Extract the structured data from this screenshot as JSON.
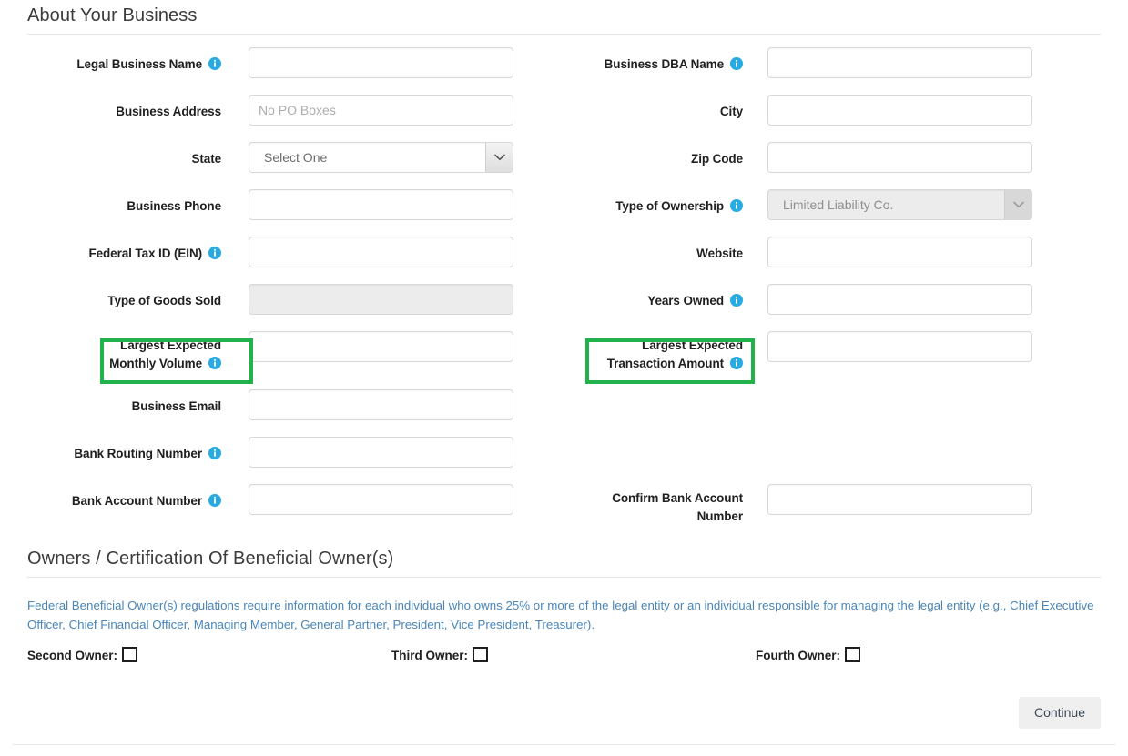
{
  "sections": {
    "business": {
      "title": "About Your Business"
    },
    "owners": {
      "title": "Owners / Certification Of Beneficial Owner(s)",
      "note": "Federal Beneficial Owner(s) regulations require information for each individual who owns 25% or more of the legal entity or an individual responsible for managing the legal entity (e.g., Chief Executive Officer, Chief Financial Officer, Managing Member, General Partner, President, Vice President, Treasurer).",
      "checkboxes": [
        {
          "label": "Second Owner:",
          "checked": false
        },
        {
          "label": "Third Owner:",
          "checked": false
        },
        {
          "label": "Fourth Owner:",
          "checked": false
        }
      ]
    }
  },
  "fields": {
    "legal_business_name": {
      "label": "Legal Business Name",
      "value": "",
      "placeholder": "",
      "info": true,
      "type": "text",
      "disabled": false
    },
    "business_dba_name": {
      "label": "Business DBA Name",
      "value": "",
      "placeholder": "",
      "info": true,
      "type": "text",
      "disabled": false
    },
    "business_address": {
      "label": "Business Address",
      "value": "",
      "placeholder": "No PO Boxes",
      "info": false,
      "type": "text",
      "disabled": false
    },
    "city": {
      "label": "City",
      "value": "",
      "placeholder": "",
      "info": false,
      "type": "text",
      "disabled": false
    },
    "state": {
      "label": "State",
      "value": "Select One",
      "info": false,
      "type": "select",
      "disabled": false
    },
    "zip_code": {
      "label": "Zip Code",
      "value": "",
      "placeholder": "",
      "info": false,
      "type": "text",
      "disabled": false
    },
    "business_phone": {
      "label": "Business Phone",
      "value": "",
      "placeholder": "",
      "info": false,
      "type": "text",
      "disabled": false
    },
    "type_of_ownership": {
      "label": "Type of Ownership",
      "value": "Limited Liability Co.",
      "info": true,
      "type": "select",
      "disabled": true
    },
    "federal_tax_id": {
      "label": "Federal Tax ID (EIN)",
      "value": "",
      "placeholder": "",
      "info": true,
      "type": "text",
      "disabled": false
    },
    "website": {
      "label": "Website",
      "value": "",
      "placeholder": "",
      "info": false,
      "type": "text",
      "disabled": false
    },
    "type_of_goods_sold": {
      "label": "Type of Goods Sold",
      "value": "",
      "placeholder": "",
      "info": false,
      "type": "text",
      "disabled": true
    },
    "years_owned": {
      "label": "Years Owned",
      "value": "",
      "placeholder": "",
      "info": true,
      "type": "text",
      "disabled": false
    },
    "largest_monthly_volume": {
      "label": "Largest Expected Monthly Volume",
      "label_line1": "Largest Expected",
      "label_line2": "Monthly Volume",
      "value": "",
      "placeholder": "",
      "info": true,
      "type": "text",
      "disabled": false,
      "highlighted": true
    },
    "largest_transaction_amount": {
      "label": "Largest Expected Transaction Amount",
      "label_line1": "Largest Expected",
      "label_line2": "Transaction Amount",
      "value": "",
      "placeholder": "",
      "info": true,
      "type": "text",
      "disabled": false,
      "highlighted": true
    },
    "business_email": {
      "label": "Business Email",
      "value": "",
      "placeholder": "",
      "info": false,
      "type": "text",
      "disabled": false
    },
    "bank_routing_number": {
      "label": "Bank Routing Number",
      "value": "",
      "placeholder": "",
      "info": true,
      "type": "text",
      "disabled": false
    },
    "bank_account_number": {
      "label": "Bank Account Number",
      "value": "",
      "placeholder": "",
      "info": true,
      "type": "text",
      "disabled": false
    },
    "confirm_bank_account_number": {
      "label": "Confirm Bank Account Number",
      "label_line1": "Confirm Bank Account",
      "label_line2": "Number",
      "value": "",
      "placeholder": "",
      "info": false,
      "type": "text",
      "disabled": false
    }
  },
  "footer": {
    "continue_label": "Continue"
  },
  "colors": {
    "highlight_green": "#22b24c",
    "info_blue": "#29abe2",
    "note_blue": "#4a86b8",
    "disabled_gray": "#ececec"
  },
  "icons": {
    "info": "info-circle-icon",
    "chevron": "chevron-down-icon"
  }
}
